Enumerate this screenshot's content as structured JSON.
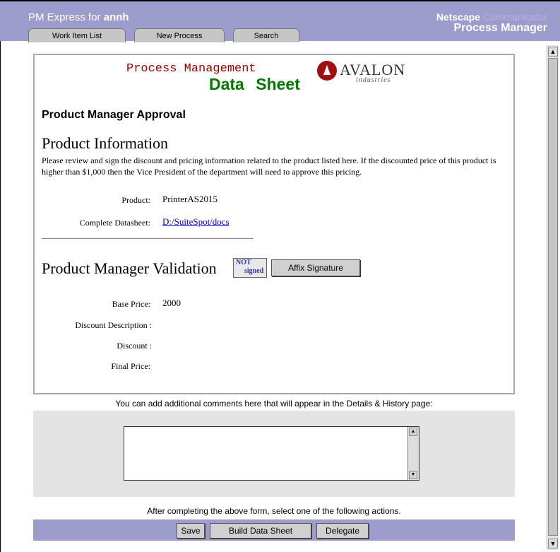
{
  "header": {
    "brand_prefix": "PM Express for",
    "user": "annh",
    "netscape": "Netscape",
    "netscape_ghost": "Communicator",
    "product": "Process Manager",
    "tabs": [
      "Work Item List",
      "New Process",
      "Search"
    ]
  },
  "logo": {
    "line1": "Process Management",
    "line2": "Data Sheet",
    "company": "AVALON",
    "company_sub": "industries"
  },
  "form": {
    "title": "Product Manager Approval",
    "info_heading": "Product Information",
    "info_desc": "Please review and sign the discount and pricing information related to the product listed here. If the discounted price of this product is higher than $1,000 then the Vice President of the department will need to approve this pricing.",
    "product_label": "Product:",
    "product_value": "PrinterAS2015",
    "datasheet_label": "Complete Datasheet:",
    "datasheet_value": "D:/SuiteSpot/docs",
    "validation_heading": "Product Manager Validation",
    "stamp_line1": "NOT",
    "stamp_line2": "signed",
    "affix_label": "Affix Signature",
    "base_price_label": "Base Price:",
    "base_price_value": "2000",
    "discount_desc_label": "Discount Description :",
    "discount_label": "Discount :",
    "final_price_label": "Final Price:"
  },
  "comments": {
    "note": "You can add additional comments here that will appear in the Details & History page:",
    "value": ""
  },
  "actions": {
    "note": "After completing the above form, select one of the following actions.",
    "save": "Save",
    "build": "Build Data Sheet",
    "delegate": "Delegate"
  },
  "colors": {
    "header_bg": "#9c9ccd",
    "pm_title": "#990000",
    "data_sheet": "#007700",
    "link": "#0000cc"
  }
}
